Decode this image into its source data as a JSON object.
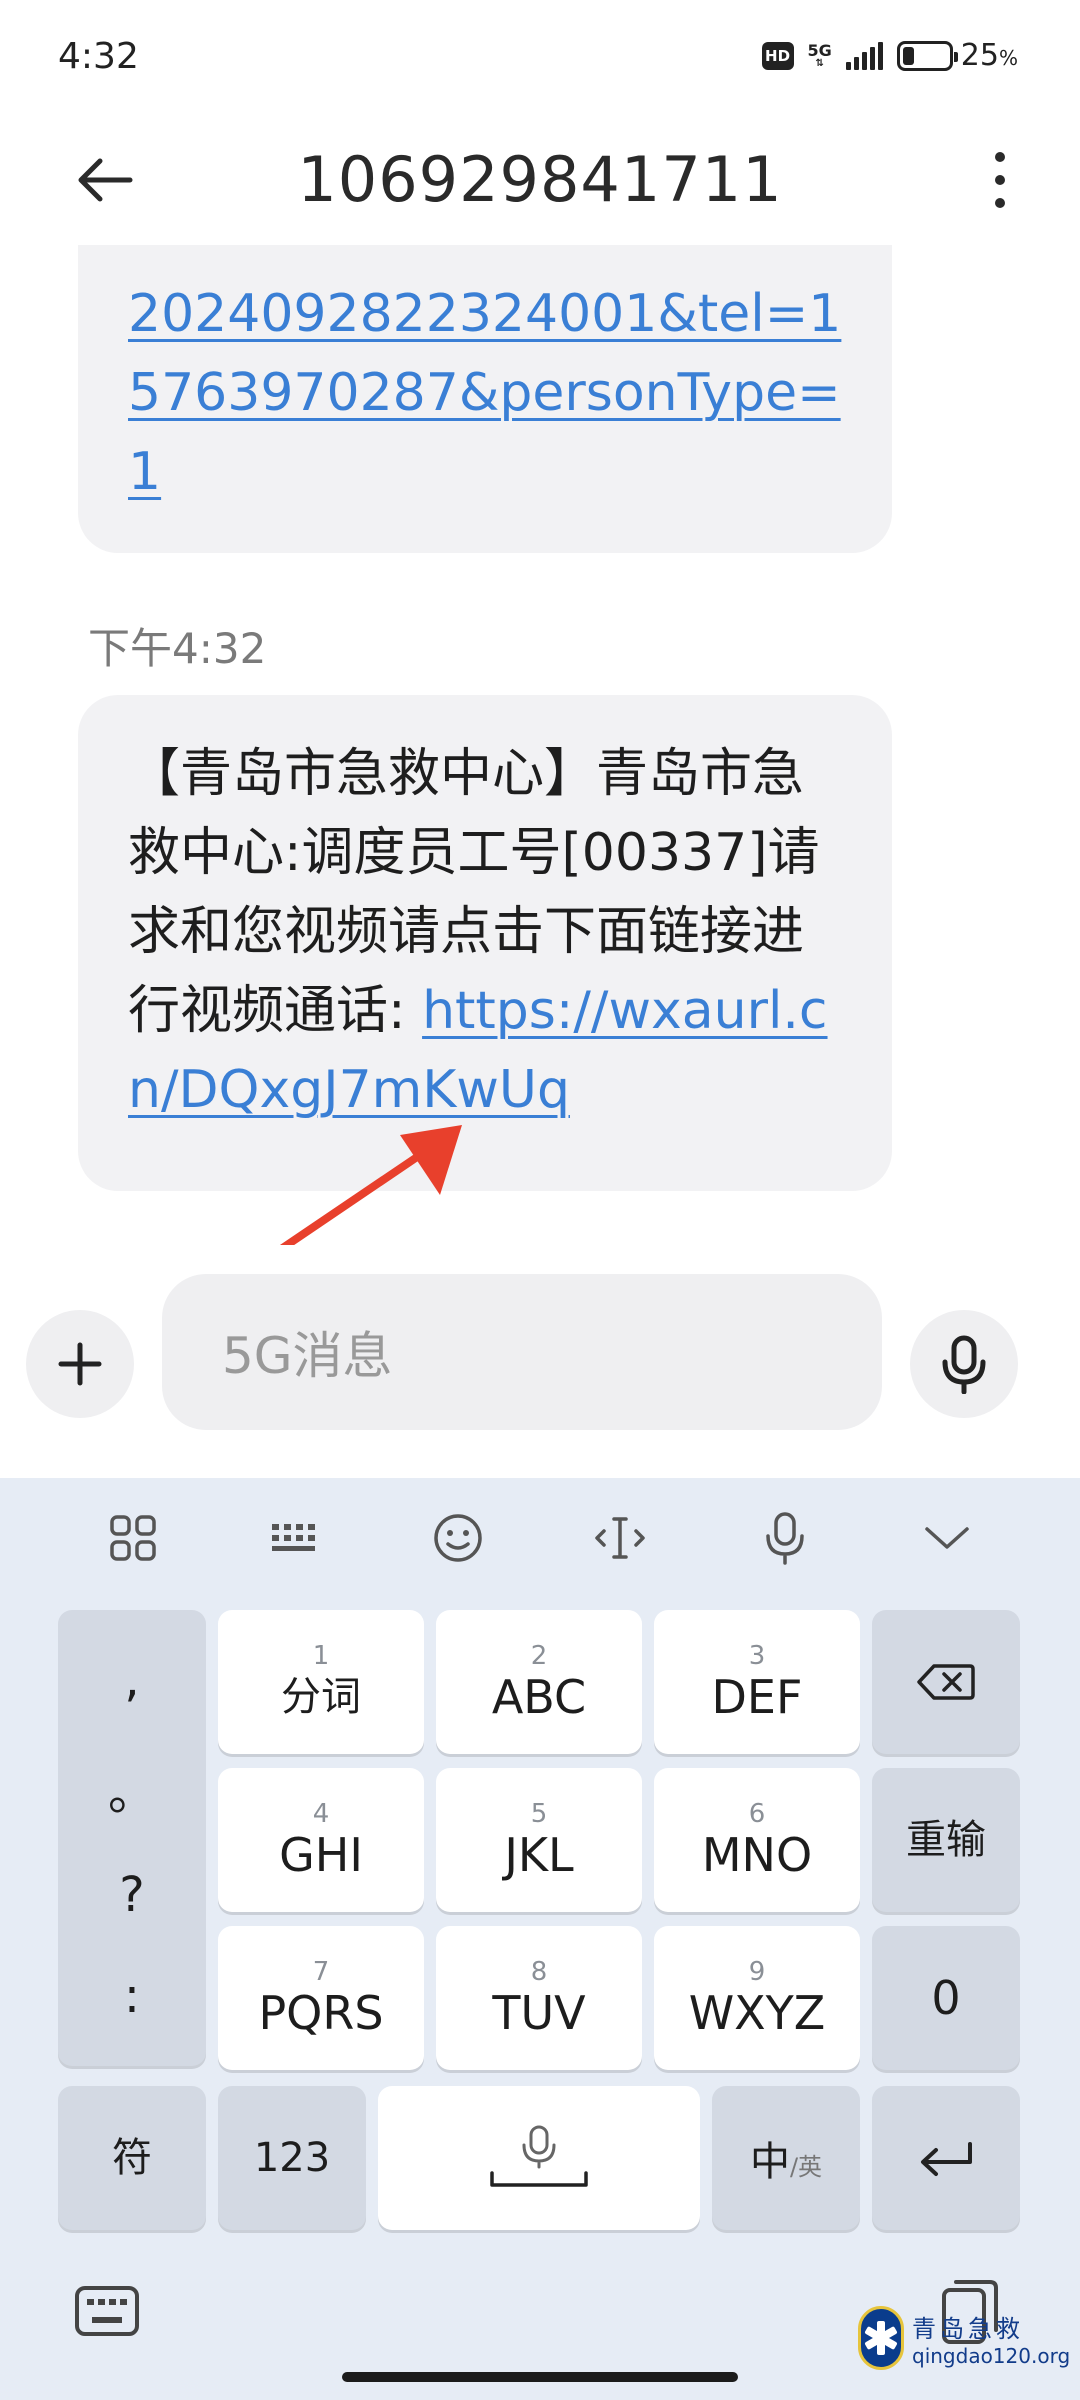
{
  "status_bar": {
    "time": "4:32",
    "hd_badge": "HD",
    "network": "5G",
    "battery_percent": "25",
    "battery_unit": "%",
    "battery_level": 0.25
  },
  "header": {
    "title": "106929841711"
  },
  "messages": {
    "first": {
      "link_text": "2024092822324001&tel=15763970287&personType=1"
    },
    "timestamp": "下午4:32",
    "second": {
      "text": "【青岛市急救中心】青岛市急救中心:调度员工号[00337]请求和您视频请点击下面链接进行视频通话: ",
      "link_text": "https://wxaurl.cn/DQxgJ7mKwUq"
    }
  },
  "input": {
    "placeholder": "5G消息"
  },
  "keyboard": {
    "punctuation": [
      ",",
      "。",
      "?",
      ":"
    ],
    "rows": [
      [
        {
          "num": "1",
          "label": "分词"
        },
        {
          "num": "2",
          "label": "ABC"
        },
        {
          "num": "3",
          "label": "DEF"
        }
      ],
      [
        {
          "num": "4",
          "label": "GHI"
        },
        {
          "num": "5",
          "label": "JKL"
        },
        {
          "num": "6",
          "label": "MNO"
        }
      ],
      [
        {
          "num": "7",
          "label": "PQRS"
        },
        {
          "num": "8",
          "label": "TUV"
        },
        {
          "num": "9",
          "label": "WXYZ"
        }
      ]
    ],
    "reinput": "重输",
    "zero": "0",
    "symbols": "符",
    "numbers": "123",
    "lang_main": "中",
    "lang_alt": "/英"
  },
  "watermark": {
    "cn": "青岛急救",
    "en": "qingdao120.org"
  },
  "colors": {
    "link": "#3a7fd5",
    "bubble": "#f2f2f4",
    "keyboard_bg": "#e6ecf5",
    "arrow": "#e8402c"
  }
}
